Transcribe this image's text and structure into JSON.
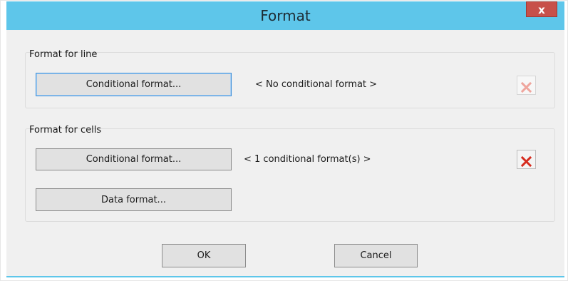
{
  "window": {
    "title": "Format",
    "close_glyph": "x"
  },
  "line_group": {
    "label": "Format for line",
    "conditional_format_button": "Conditional format...",
    "status": "< No conditional format >",
    "remove_icon": "x-icon",
    "remove_enabled": false
  },
  "cells_group": {
    "label": "Format for cells",
    "conditional_format_button": "Conditional format...",
    "status": "< 1 conditional format(s) >",
    "data_format_button": "Data format...",
    "remove_icon": "x-icon",
    "remove_enabled": true
  },
  "footer": {
    "ok_label": "OK",
    "cancel_label": "Cancel"
  },
  "colors": {
    "titlebar": "#5ec6ea",
    "close_button": "#c7504a",
    "remove_icon_enabled": "#d62b1e",
    "remove_icon_disabled": "#efa59d"
  }
}
